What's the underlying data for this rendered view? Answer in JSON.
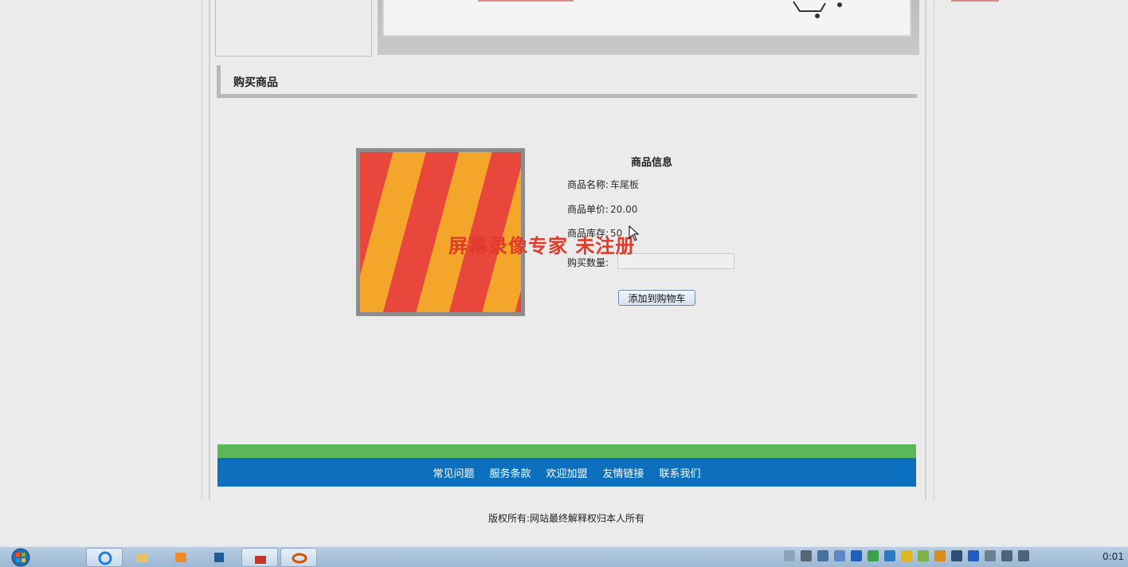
{
  "section": {
    "title": "购买商品"
  },
  "product": {
    "image_name": "车尾板",
    "info_title": "商品信息",
    "name_label": "商品名称:",
    "name_value": "车尾板",
    "price_label": "商品单价:",
    "price_value": "20.00",
    "stock_label": "商品库存:",
    "stock_value": "50",
    "qty_label": "购买数量:",
    "qty_value": "",
    "add_button": "添加到购物车"
  },
  "watermark": "屏幕录像专家  未注册",
  "footer": {
    "links": [
      "常见问题",
      "服务条款",
      "欢迎加盟",
      "友情链接",
      "联系我们"
    ],
    "copyright": "版权所有:网站最终解释权归本人所有",
    "green": "#5cb65a",
    "blue": "#0d70bf"
  },
  "taskbar": {
    "clock": "0:01",
    "apps": [
      "start-orb-icon",
      "ie-icon",
      "explorer-icon",
      "media-player-icon",
      "app-icon",
      "toolbox-icon",
      "browser-icon"
    ]
  }
}
